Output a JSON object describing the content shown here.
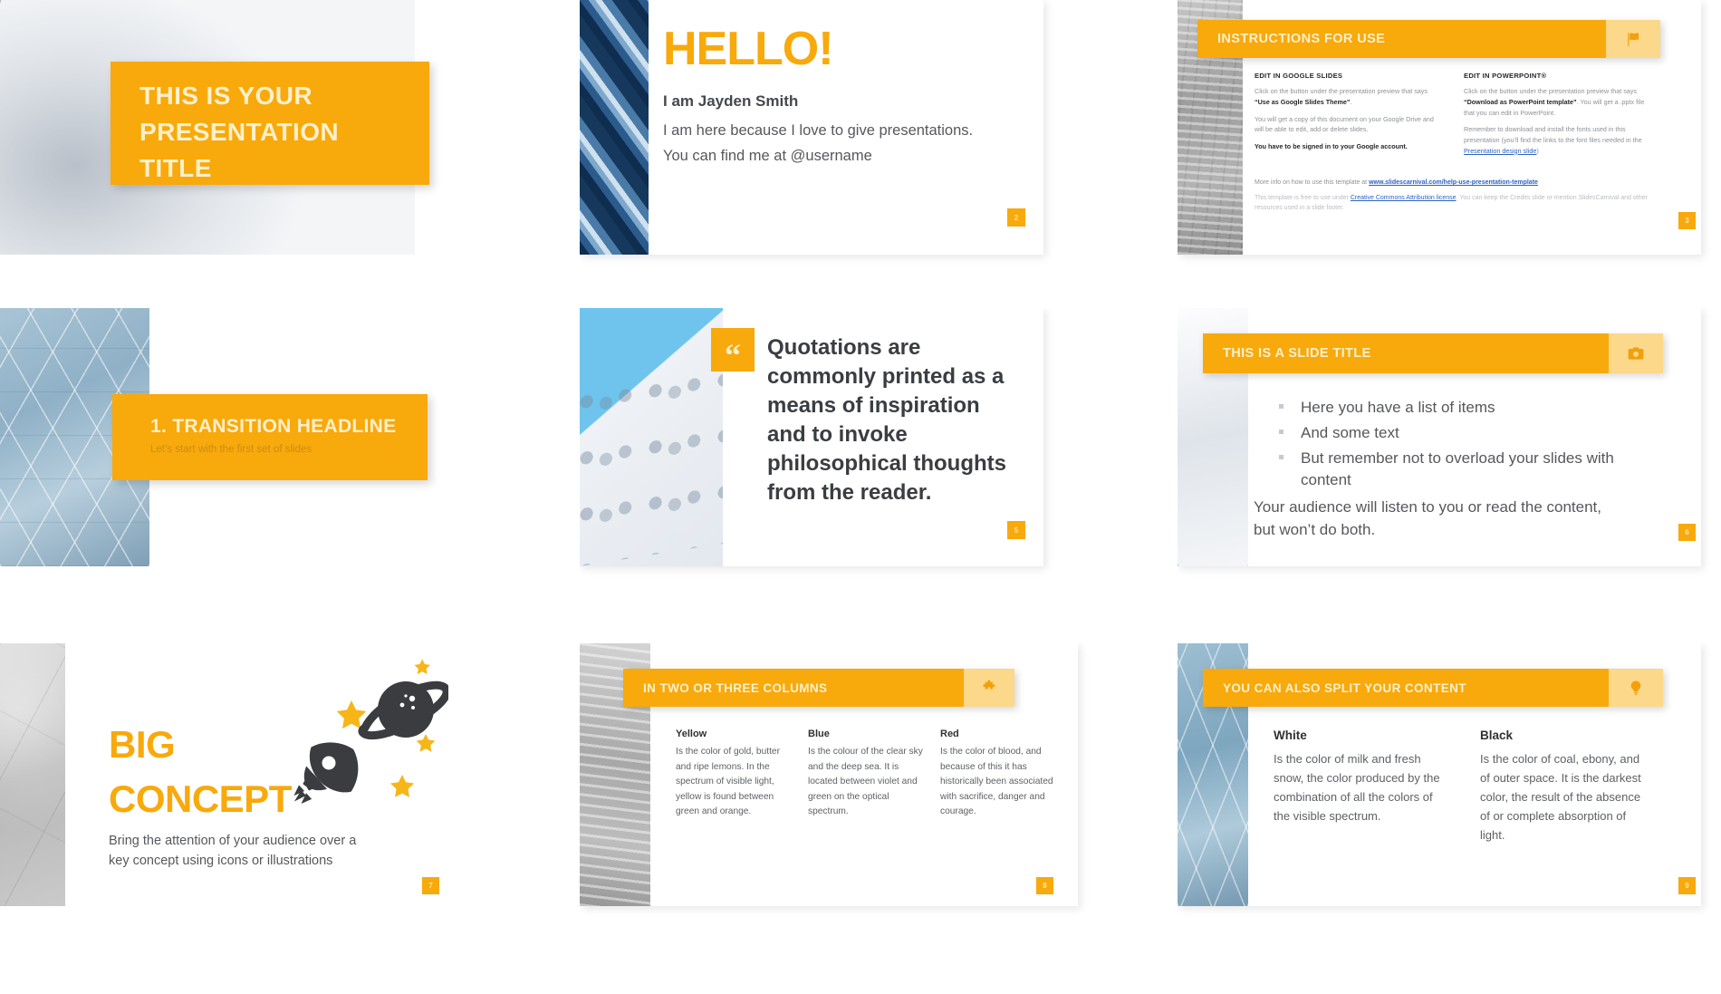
{
  "theme": {
    "accent": "#F8A90B",
    "accent_light": "#FCD88A",
    "title_text": "#FFF0CC",
    "dark_text": "#2f3133",
    "body_text": "#55585c",
    "muted_text": "#8d9196",
    "link": "#2b63c4"
  },
  "slides": [
    {
      "id": "title-slide",
      "title_line1": "THIS IS YOUR",
      "title_line2": "PRESENTATION",
      "title_line3": "TITLE",
      "photo": "white-architecture"
    },
    {
      "id": "hello-slide",
      "heading": "HELLO!",
      "name": "I am Jayden Smith",
      "line2": "I am here because I love to give presentations.",
      "line3": "You can find me at @username",
      "page": "2",
      "photo": "blue-glass-facade"
    },
    {
      "id": "instructions-slide",
      "bar_title": "INSTRUCTIONS FOR USE",
      "bar_icon": "flag-icon",
      "page": "3",
      "columns": [
        {
          "heading": "EDIT IN GOOGLE SLIDES",
          "paragraphs": [
            {
              "runs": [
                {
                  "text": "Click on the button under the presentation preview that says ",
                  "style": "normal"
                },
                {
                  "text": "“Use as Google Slides Theme”",
                  "style": "bold"
                },
                {
                  "text": ".",
                  "style": "normal"
                }
              ]
            },
            {
              "runs": [
                {
                  "text": "You will get a copy of this document on your Google Drive and will be able to edit, add or delete slides.",
                  "style": "normal"
                }
              ]
            },
            {
              "runs": [
                {
                  "text": "You have to be signed in to your Google account.",
                  "style": "bold"
                }
              ]
            }
          ]
        },
        {
          "heading": "EDIT IN POWERPOINT®",
          "paragraphs": [
            {
              "runs": [
                {
                  "text": "Click on the button under the presentation preview that says ",
                  "style": "normal"
                },
                {
                  "text": "“Download as PowerPoint template”",
                  "style": "bold"
                },
                {
                  "text": ". You will get a .pptx file that you can edit in PowerPoint.",
                  "style": "normal"
                }
              ]
            },
            {
              "runs": [
                {
                  "text": "Remember to download and install the fonts used in this presentation (you’ll find the links to the font files needed in the ",
                  "style": "normal"
                },
                {
                  "text": "Presentation design slide",
                  "style": "link"
                },
                {
                  "text": ")",
                  "style": "normal"
                }
              ]
            }
          ]
        }
      ],
      "footer": [
        {
          "runs": [
            {
              "text": "More info on how to use this template at ",
              "style": "normal"
            },
            {
              "text": "www.slidescarnival.com/help-use-presentation-template",
              "style": "link"
            }
          ]
        },
        {
          "runs": [
            {
              "text": "This template is free to use under ",
              "style": "normal"
            },
            {
              "text": "Creative Commons Attribution license",
              "style": "link"
            },
            {
              "text": ". You can keep the Credits slide or mention SlidesCarnival and other resources used in a slide footer.",
              "style": "normal"
            }
          ]
        }
      ]
    },
    {
      "id": "transition-slide",
      "headline": "1. TRANSITION HEADLINE",
      "subtitle": "Let’s start with the first set of slides",
      "photo": "glass-grid-facade"
    },
    {
      "id": "quote-slide",
      "quote_mark": "“",
      "quote": "Quotations are commonly printed as a means of inspiration and to invoke philosophical thoughts from the reader.",
      "page": "5",
      "photo": "white-building-blue-sky"
    },
    {
      "id": "list-slide",
      "bar_title": "THIS IS A SLIDE TITLE",
      "bar_icon": "camera-icon",
      "page": "6",
      "bullets": [
        "Here you have a list of items",
        "And some text",
        "But remember not to overload your slides with content"
      ],
      "paragraph": "Your audience will listen to you or read the content, but won’t do both.",
      "photo": "white-architecture"
    },
    {
      "id": "big-concept-slide",
      "title_line1": "BIG",
      "title_line2": "CONCEPT",
      "subtitle": "Bring the attention of your audience over a key concept using icons or illustrations",
      "page": "7",
      "illustration": "rocket-planet-stars",
      "photo": "concrete-texture"
    },
    {
      "id": "columns-slide",
      "bar_title": "IN TWO OR THREE COLUMNS",
      "bar_icon": "puzzle-icon",
      "page": "8",
      "photo": "gray-wall",
      "columns": [
        {
          "heading": "Yellow",
          "text": "Is the color of gold, butter and ripe lemons. In the spectrum of visible light, yellow is found between green and orange."
        },
        {
          "heading": "Blue",
          "text": "Is the colour of the clear sky and the deep sea. It is located between violet and green on the optical spectrum."
        },
        {
          "heading": "Red",
          "text": "Is the color of blood, and because of this it has historically been associated with sacrifice, danger and courage."
        }
      ]
    },
    {
      "id": "split-content-slide",
      "bar_title": "YOU CAN ALSO SPLIT YOUR CONTENT",
      "bar_icon": "lightbulb-icon",
      "page": "9",
      "photo": "glass-grid-facade",
      "columns": [
        {
          "heading": "White",
          "text": "Is the color of milk and fresh snow, the color produced by the combination of all the colors of the visible spectrum."
        },
        {
          "heading": "Black",
          "text": "Is the color of coal, ebony, and of outer space. It is the darkest color, the result of the absence of or complete absorption of light."
        }
      ]
    }
  ]
}
